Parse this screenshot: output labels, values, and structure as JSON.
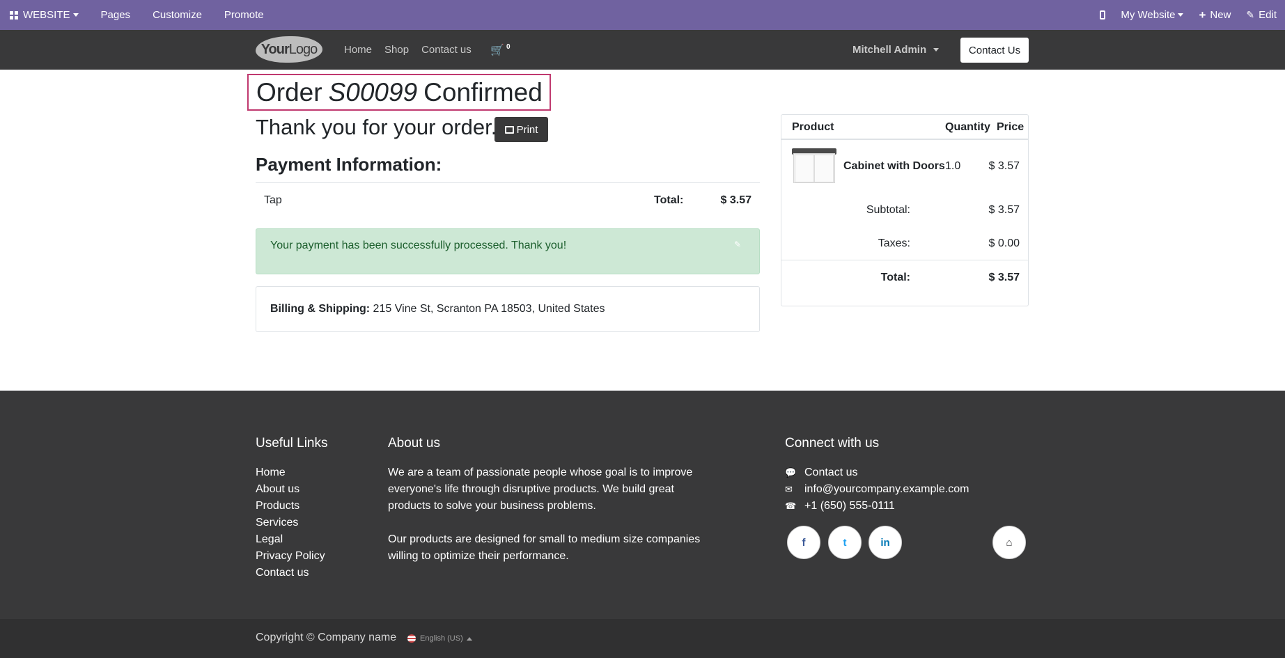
{
  "admin_bar": {
    "website_label": "WEBSITE",
    "pages_label": "Pages",
    "customize_label": "Customize",
    "promote_label": "Promote",
    "my_website_label": "My Website",
    "new_label": "New",
    "edit_label": "Edit"
  },
  "navbar": {
    "logo_text_bold": "Your",
    "logo_text": "Logo",
    "links": [
      "Home",
      "Shop",
      "Contact us"
    ],
    "cart_count": "0",
    "user": "Mitchell Admin",
    "contact_button": "Contact Us"
  },
  "order": {
    "title_prefix": "Order",
    "order_ref": "S00099",
    "title_suffix": "Confirmed",
    "thanks": "Thank you for your order.",
    "print_label": "Print",
    "payment_heading": "Payment Information:",
    "payment_method": "Tap",
    "total_label": "Total:",
    "total_value": "$ 3.57",
    "success_message": "Your payment has been successfully processed. Thank you!",
    "billing_label": "Billing & Shipping:",
    "billing_address": "215 Vine St, Scranton PA 18503, United States"
  },
  "summary": {
    "headers": {
      "product": "Product",
      "quantity": "Quantity",
      "price": "Price"
    },
    "item": {
      "name": "Cabinet with Doors",
      "quantity": "1.0",
      "price": "$ 3.57"
    },
    "subtotal_label": "Subtotal:",
    "subtotal_value": "$ 3.57",
    "taxes_label": "Taxes:",
    "taxes_value": "$ 0.00",
    "total_label": "Total:",
    "total_value": "$ 3.57"
  },
  "footer": {
    "useful_links_title": "Useful Links",
    "useful_links": [
      "Home",
      "About us",
      "Products",
      "Services",
      "Legal",
      "Privacy Policy",
      "Contact us"
    ],
    "about_title": "About us",
    "about_p1": "We are a team of passionate people whose goal is to improve everyone's life through disruptive products. We build great products to solve your business problems.",
    "about_p2": "Our products are designed for small to medium size companies willing to optimize their performance.",
    "connect_title": "Connect with us",
    "contact_us": "Contact us",
    "email": "info@yourcompany.example.com",
    "phone": "+1 (650) 555-0111",
    "social": {
      "facebook": "f",
      "twitter": "t",
      "linkedin": "in"
    },
    "copyright": "Copyright © Company name",
    "language": "English (US)"
  },
  "colors": {
    "admin_bar": "#7062a0",
    "navbar": "#39393a",
    "highlight_border": "#c0396f",
    "success_bg": "#cde8d5",
    "success_text": "#1b5e2c"
  }
}
